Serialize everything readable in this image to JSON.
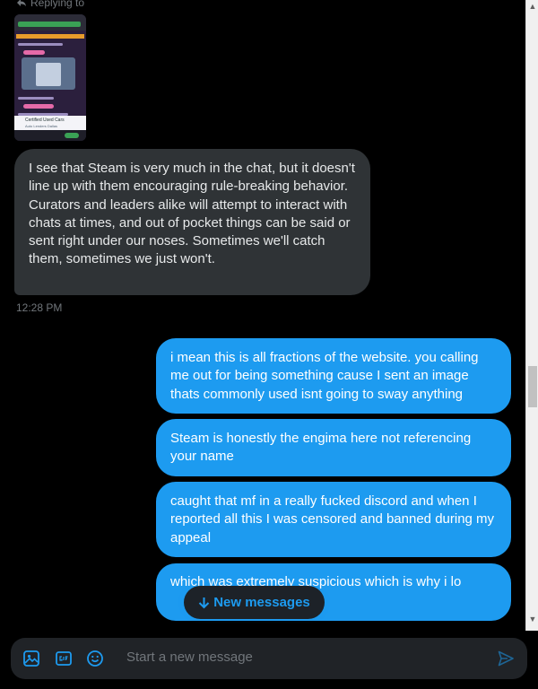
{
  "thread": {
    "replying_to": "Replying to",
    "shared_image": {
      "card_title": "Certified Used Cars",
      "card_subtitle": "Auto Lenders Dallas"
    },
    "received": {
      "text": "I see that Steam is very much in the chat, but it doesn't line up with them encouraging rule-breaking behavior. Curators and leaders alike will attempt to interact with chats at times, and out of pocket things can be said or sent right under our noses. Sometimes we'll catch them, sometimes we just won't.",
      "time": "12:28 PM"
    },
    "sent": [
      {
        "text": "i mean this is all fractions of the website. you calling me out for being something cause I sent an image thats commonly used isnt going to sway anything"
      },
      {
        "text": "Steam is honestly the engima here not referencing your name"
      },
      {
        "text": "caught that mf in a really fucked discord and when I reported all this I was censored and banned during my appeal"
      },
      {
        "text": "which was extremely suspicious which is why i lo"
      }
    ]
  },
  "new_messages_button": {
    "label": "New messages",
    "icon": "arrow-down-icon"
  },
  "composer": {
    "placeholder": "Start a new message",
    "icons": [
      "image-icon",
      "gif-icon",
      "emoji-icon",
      "send-icon"
    ]
  },
  "colors": {
    "accent": "#1d9bf0",
    "received_bubble": "#2f3336",
    "background": "#000000"
  }
}
